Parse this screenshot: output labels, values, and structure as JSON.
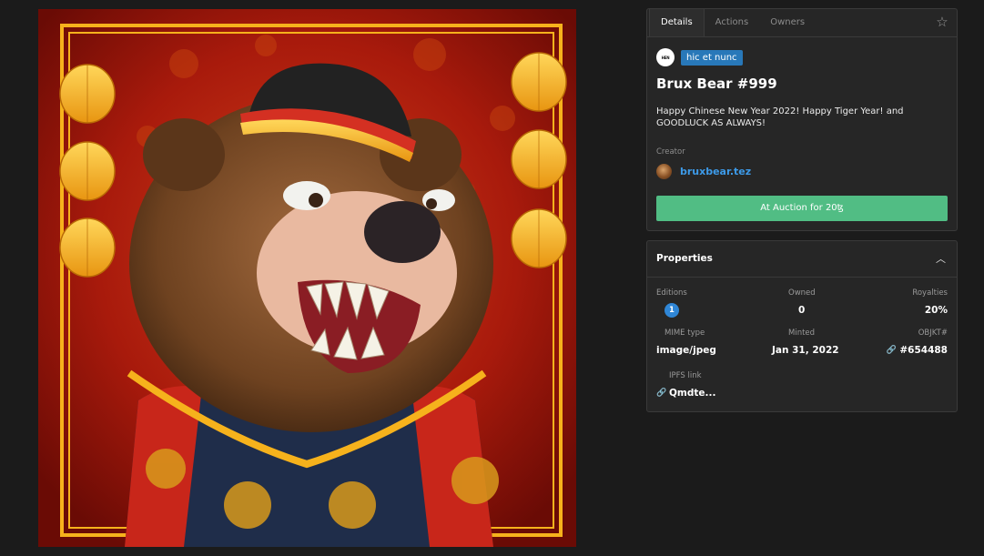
{
  "tabs": [
    {
      "label": "Details",
      "active": true
    },
    {
      "label": "Actions",
      "active": false
    },
    {
      "label": "Owners",
      "active": false
    }
  ],
  "icons": {
    "favorite": "star-icon",
    "collapse": "chevron-up-icon",
    "link": "link-icon"
  },
  "platform": {
    "logo_text": "HEN",
    "badge": "hic et nunc"
  },
  "token": {
    "title": "Brux Bear #999",
    "description": "Happy Chinese New Year 2022! Happy Tiger Year! and GOODLUCK AS ALWAYS!"
  },
  "creator": {
    "label": "Creator",
    "name": "bruxbear.tez"
  },
  "auction": {
    "label": "At Auction for 20ꜩ"
  },
  "properties": {
    "title": "Properties",
    "editions": {
      "label": "Editions",
      "value": "1"
    },
    "owned": {
      "label": "Owned",
      "value": "0"
    },
    "royalties": {
      "label": "Royalties",
      "value": "20%"
    },
    "mime": {
      "label": "MIME type",
      "value": "image/jpeg"
    },
    "minted": {
      "label": "Minted",
      "value": "Jan 31, 2022"
    },
    "objkt": {
      "label": "OBJKT#",
      "value": "#654488"
    },
    "ipfs": {
      "label": "IPFS link",
      "value": "Qmdte..."
    }
  },
  "colors": {
    "accent_green": "#51bd84",
    "badge_blue": "#2878b9",
    "link_blue": "#3d9ae8",
    "panel_bg": "#262626",
    "page_bg": "#1b1b1b"
  }
}
